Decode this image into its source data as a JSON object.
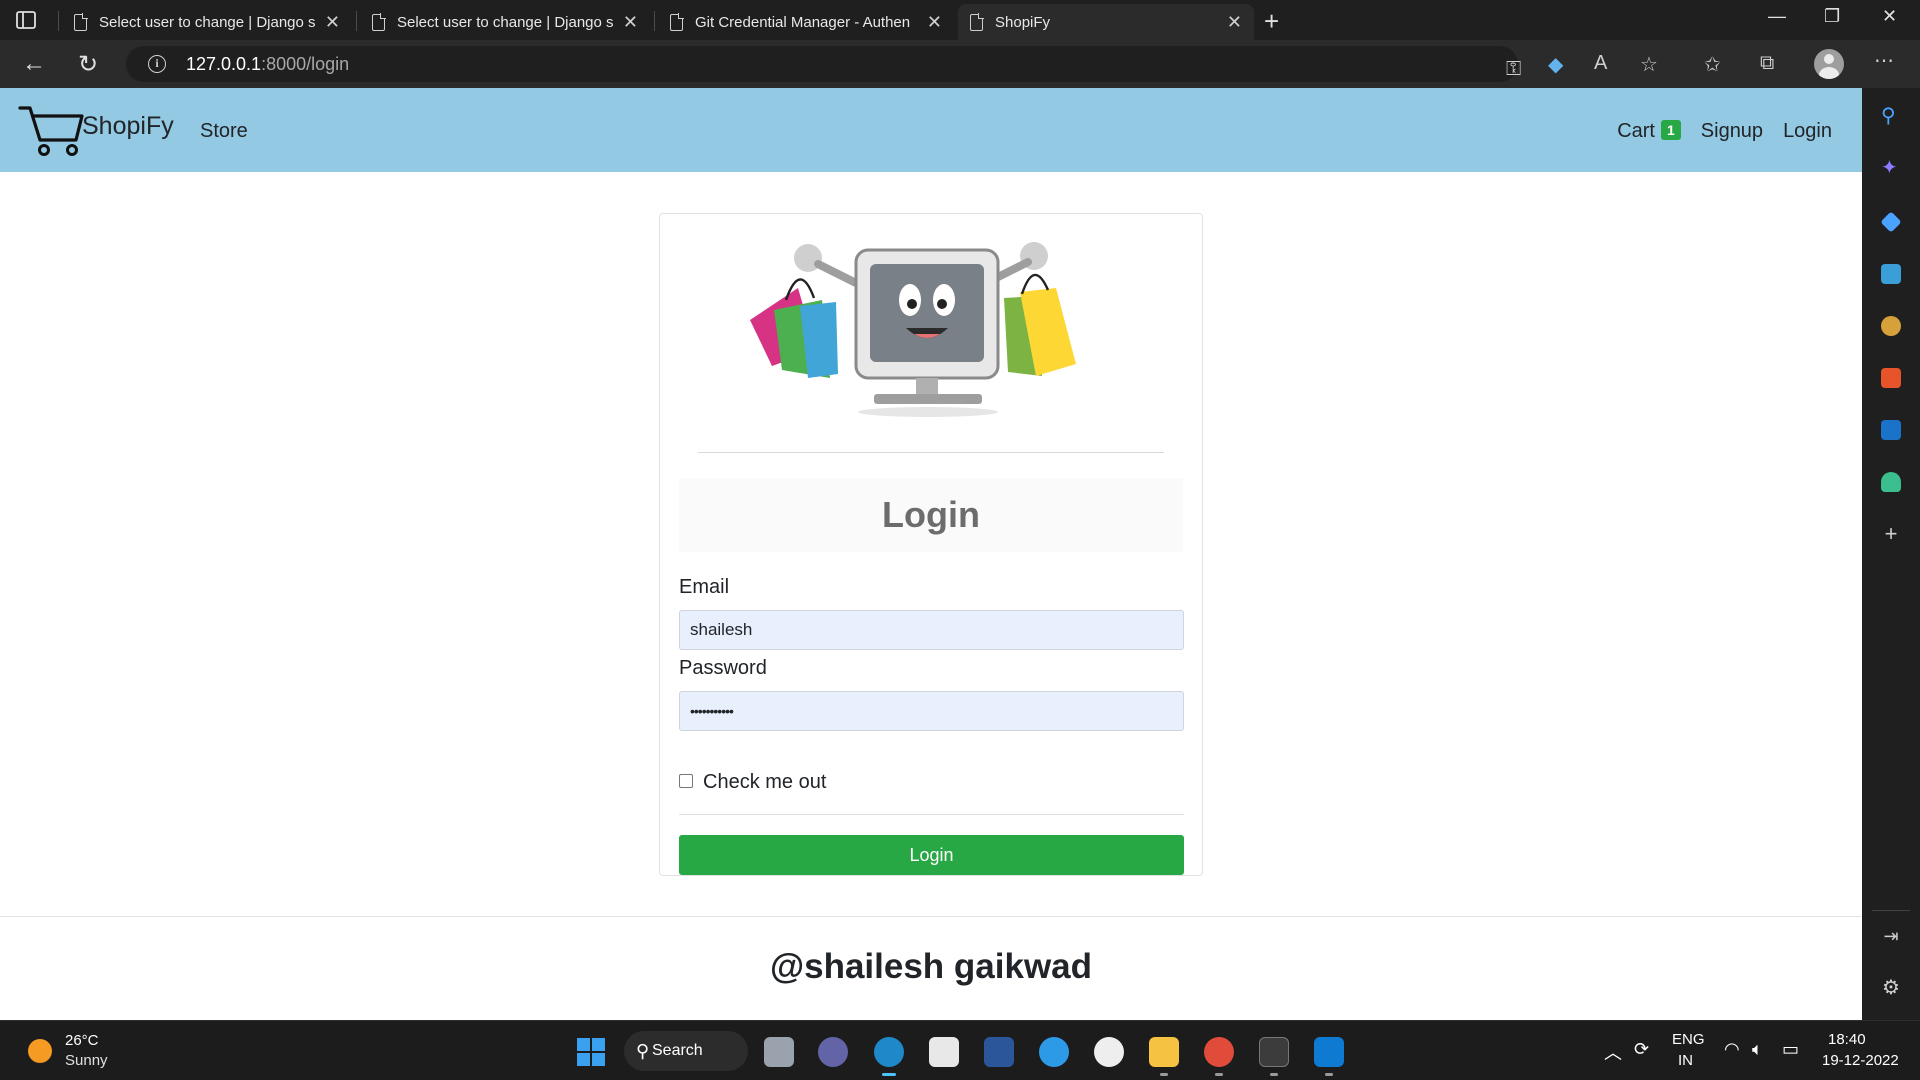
{
  "browser": {
    "tabs": [
      {
        "label": "Select user to change | Django si",
        "active": false
      },
      {
        "label": "Select user to change | Django si",
        "active": false
      },
      {
        "label": "Git Credential Manager - Authen",
        "active": false
      },
      {
        "label": "ShopiFy",
        "active": true
      }
    ],
    "url_host": "127.0.0.1",
    "url_path": ":8000/login"
  },
  "navbar": {
    "brand": "ShopiFy",
    "store": "Store",
    "cart": "Cart",
    "cart_count": "1",
    "signup": "Signup",
    "login": "Login"
  },
  "form": {
    "heading": "Login",
    "email_label": "Email",
    "email_value": "shailesh",
    "password_label": "Password",
    "password_value": "•••••••••••",
    "checkbox_label": "Check me out",
    "submit_label": "Login"
  },
  "footer": {
    "text": "@shailesh gaikwad"
  },
  "taskbar": {
    "temperature": "26°C",
    "condition": "Sunny",
    "search_label": "Search",
    "lang_top": "ENG",
    "lang_bottom": "IN",
    "time": "18:40",
    "date": "19-12-2022"
  },
  "colors": {
    "navbar_bg": "#93c9e2",
    "button_bg": "#28a745",
    "badge_bg": "#28a745",
    "input_bg": "#e8f0fe"
  }
}
